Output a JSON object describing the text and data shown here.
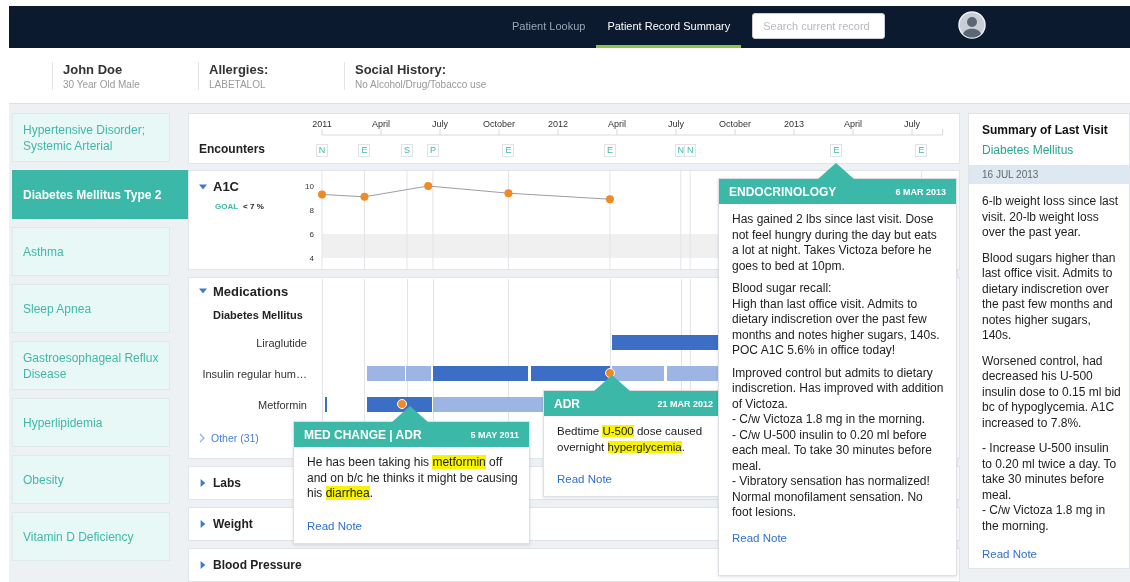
{
  "nav": {
    "links": [
      {
        "label": "Patient Lookup",
        "selected": false
      },
      {
        "label": "Patient Record Summary",
        "selected": true
      }
    ],
    "search": {
      "placeholder": "Search current record"
    }
  },
  "patient": [
    {
      "label": "John Doe",
      "value": "30 Year Old Male"
    },
    {
      "label": "Allergies:",
      "value": "LABETALOL"
    },
    {
      "label": "Social History:",
      "value": "No Alcohol/Drug/Tobacco use"
    }
  ],
  "conditions": [
    {
      "label": "Hypertensive Disorder; Systemic Arterial",
      "selected": false
    },
    {
      "label": "Diabetes Mellitus Type 2",
      "selected": true
    },
    {
      "label": "Asthma",
      "selected": false
    },
    {
      "label": "Sleep Apnea",
      "selected": false
    },
    {
      "label": "Gastroesophageal Reflux Disease",
      "selected": false
    },
    {
      "label": "Hyperlipidemia",
      "selected": false
    },
    {
      "label": "Obesity",
      "selected": false
    },
    {
      "label": "Vitamin D Deficiency",
      "selected": false
    }
  ],
  "encounters": {
    "label": "Encounters",
    "markers": [
      "N",
      "E",
      "S",
      "P",
      "E",
      "E",
      "N",
      "N",
      "E",
      "E"
    ]
  },
  "sections": [
    {
      "kind": "chart",
      "expanded": true,
      "goal_label": "GOAL",
      "goal": "< 7 %",
      "chart_data": {
        "type": "line",
        "x": [
          2011.0,
          2011.18,
          2011.45,
          2011.79,
          2012.22
        ],
        "xticks": [
          {
            "value": 2011,
            "label": "2011"
          },
          {
            "value": 2011.25,
            "label": "April"
          },
          {
            "value": 2011.5,
            "label": "July"
          },
          {
            "value": 2011.75,
            "label": "October"
          },
          {
            "value": 2012,
            "label": "2012"
          },
          {
            "value": 2012.25,
            "label": "April"
          },
          {
            "value": 2012.5,
            "label": "July"
          },
          {
            "value": 2012.75,
            "label": "October"
          },
          {
            "value": 2013,
            "label": "2013"
          },
          {
            "value": 2013.25,
            "label": "April"
          },
          {
            "value": 2013.5,
            "label": "July"
          }
        ],
        "xlim": [
          2011,
          2013.63
        ],
        "bands": [
          {
            "axis": "y",
            "from": 4,
            "to": 6
          }
        ],
        "yticks": [
          {
            "value": 4,
            "label": "4"
          },
          {
            "value": 6,
            "label": "6"
          },
          {
            "value": 8,
            "label": "8"
          },
          {
            "value": 10,
            "label": "10"
          }
        ],
        "ylim": [
          2.92,
          11.25
        ],
        "series": [
          {
            "name": "A1C",
            "color": "#f08a24",
            "marker": true,
            "values": [
              9.3,
              9.1,
              10,
              9.4,
              8.9
            ]
          }
        ]
      }
    },
    {
      "kind": "medications",
      "title": "Medications",
      "expanded": true,
      "group": "Diabetes Mellitus",
      "more": "Other (31)",
      "meds": [
        {
          "name": "Liraglutide",
          "alert": false,
          "segments": [
            {
              "dark": true
            }
          ]
        },
        {
          "name": "Insulin regular hum…",
          "alert": true,
          "segments": [
            {
              "dark": false
            },
            {
              "dark": false
            },
            {
              "dark": true
            },
            {
              "dark": true
            },
            {
              "dark": false
            },
            {
              "dark": false
            }
          ]
        },
        {
          "name": "Metformin",
          "alert": true,
          "segments": [
            {
              "dark": true
            },
            {
              "dark": true
            },
            {
              "dark": false
            }
          ]
        }
      ]
    },
    {
      "kind": "plain",
      "title": "Labs",
      "expanded": false
    },
    {
      "kind": "plain",
      "title": "Weight",
      "expanded": false
    },
    {
      "kind": "plain",
      "title": "Blood Pressure",
      "expanded": false
    }
  ],
  "notes": [
    {
      "title": "MED CHANGE | ADR",
      "date": "5 MAY 2011",
      "link": "Read Note",
      "paragraphs": [
        [
          {
            "text": "He has been taking his ",
            "highlight": false
          },
          {
            "text": "metformin",
            "highlight": true
          },
          {
            "text": " off and on b/c he thinks it might be causing his ",
            "highlight": false
          },
          {
            "text": "diarrhea",
            "highlight": true
          },
          {
            "text": ".",
            "highlight": false
          }
        ]
      ]
    },
    {
      "title": "ADR",
      "date": "21 MAR 2012",
      "link": "Read Note",
      "paragraphs": [
        [
          {
            "text": "Bedtime ",
            "highlight": false
          },
          {
            "text": "U-500",
            "highlight": true
          },
          {
            "text": " dose caused overnight ",
            "highlight": false
          },
          {
            "text": "hyperglycemia",
            "highlight": true
          },
          {
            "text": ".",
            "highlight": false
          }
        ]
      ]
    },
    {
      "title": "ENDOCRINOLOGY",
      "date": "6 MAR 2013",
      "link": "Read Note",
      "paragraphs": [
        [
          {
            "text": "Has gained 2 lbs since last visit. Dose not feel hungry during the day but eats a lot at night. Takes Victoza before he goes to bed at 10pm.",
            "highlight": false
          }
        ],
        [
          {
            "text": "Blood sugar recall:\nHigh than last office visit. Admits to dietary indiscretion over the past few months and notes higher sugars, 140s. POC A1C 5.6% in office today!",
            "highlight": false
          }
        ],
        [
          {
            "text": "Improved control but admits to dietary indiscretion. Has improved with addition of Victoza.\n-  C/w Victoza 1.8 mg in the morning.\n-  C/w U-500 insulin to 0.20 ml before each meal.  To take 30 minutes before meal.\n-  Vibratory sensation has normalized! Normal monofilament sensation. No foot lesions.",
            "highlight": false
          }
        ]
      ]
    }
  ],
  "summary": {
    "title": "Summary of Last Visit",
    "condition": "Diabetes Mellitus",
    "date": "16 JUL 2013",
    "link": "Read Note",
    "paragraphs": [
      "6-lb weight loss since last visit. 20-lb weight loss over the past year.",
      "Blood sugars higher than last office visit. Admits to dietary indiscretion over the past few months and notes higher sugars, 140s.",
      "Worsened control, had decreased his U-500 insulin dose to 0.15 ml bid bc of hypoglycemia.  A1C increased to 7.8%.",
      "-  Increase U-500 insulin to 0.20 ml twice a day.  To take 30 minutes before meal.\n-  C/w Victoza 1.8 mg in the morning."
    ]
  }
}
